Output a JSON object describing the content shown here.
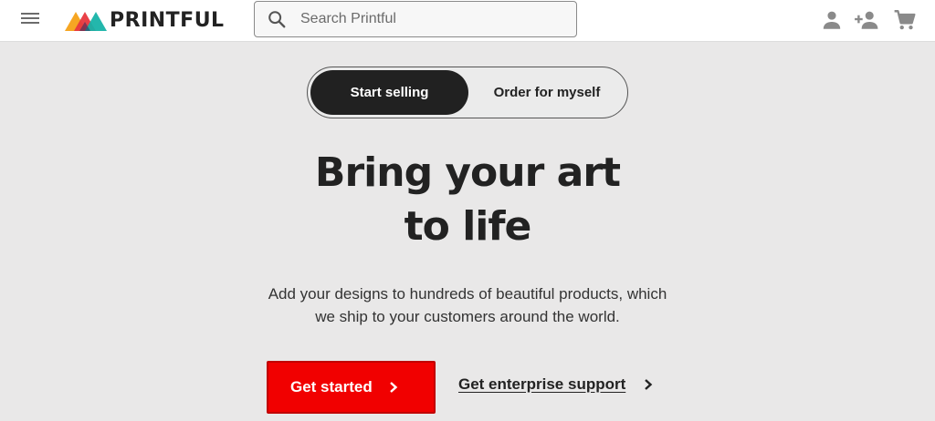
{
  "header": {
    "menu_icon": "hamburger-menu-icon",
    "logo_text": "PRINTFUL",
    "search": {
      "placeholder": "Search Printful",
      "value": ""
    },
    "icons": [
      "account-icon",
      "add-user-icon",
      "cart-icon"
    ]
  },
  "toggle": {
    "options": [
      {
        "label": "Start selling",
        "active": true
      },
      {
        "label": "Order for myself",
        "active": false
      }
    ]
  },
  "hero": {
    "title_line1": "Bring your art",
    "title_line2": "to life",
    "subtitle_line1": "Add your designs to hundreds of beautiful products, which",
    "subtitle_line2": "we ship to your customers around the world.",
    "primary_cta": "Get started",
    "secondary_cta": "Get enterprise support"
  },
  "colors": {
    "accent_red": "#f10000",
    "toggle_active_bg": "#212121",
    "background": "#e9e8e8",
    "logo_orange": "#f6a623",
    "logo_red": "#e8373e",
    "logo_teal": "#17b3a8"
  }
}
